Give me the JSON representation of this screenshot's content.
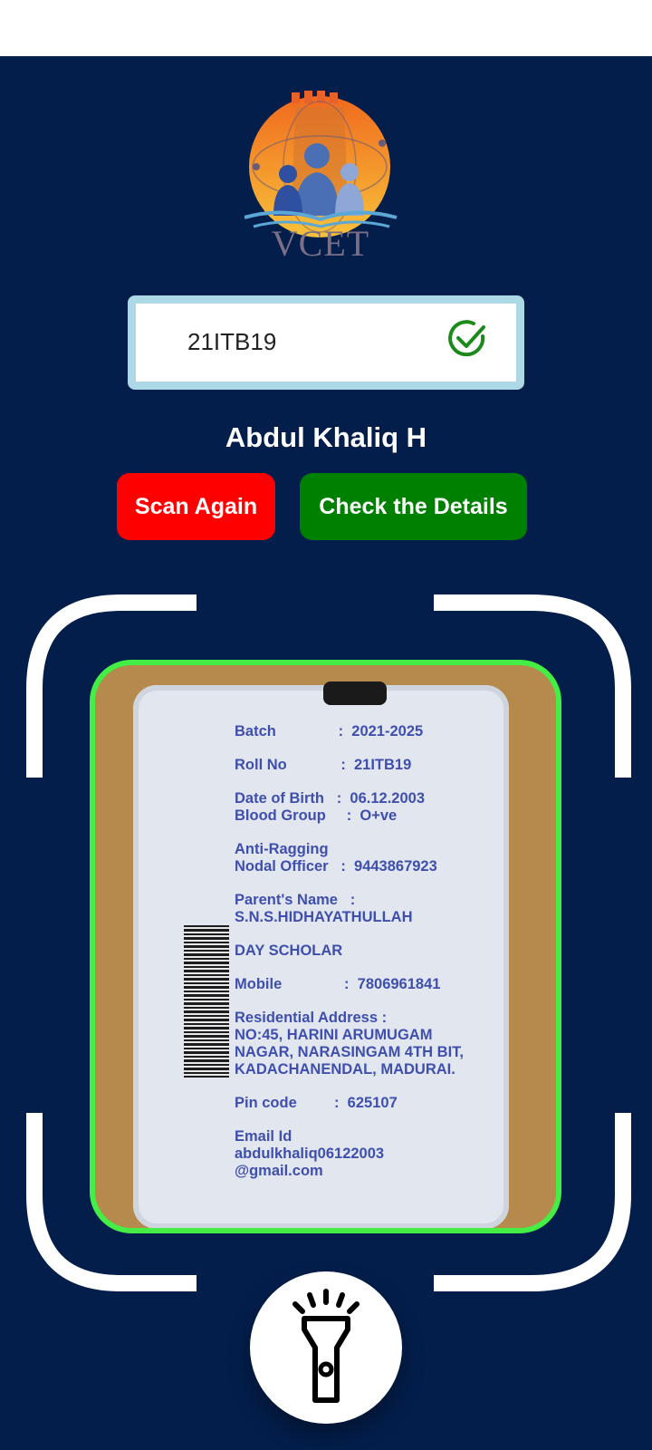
{
  "logo": {
    "text": "VCET",
    "icon": "vcet-logo",
    "colors": {
      "sun": "#f2981f",
      "people": "#4a6fb5",
      "water": "#5ba7d6"
    }
  },
  "scan": {
    "roll_number": "21ITB19",
    "status_icon": "check-circle-icon",
    "status_color": "#1b8a1b"
  },
  "student": {
    "name": "Abdul Khaliq H"
  },
  "actions": {
    "scan_again_label": "Scan Again",
    "check_details_label": "Check the Details",
    "scan_again_color": "#ff0000",
    "check_details_color": "#008000"
  },
  "camera_preview": {
    "border_color": "#44ee44",
    "card_text": [
      "Batch               :  2021-2025",
      "Roll No             :  21ITB19",
      "Date of Birth   :  06.12.2003",
      "Blood Group     :  O+ve",
      "Anti-Ragging",
      "Nodal Officer   :  9443867923",
      "Parent's Name   :",
      "S.N.S.HIDHAYATHULLAH",
      "DAY SCHOLAR",
      "Mobile               :  7806961841",
      "Residential Address :",
      "NO:45, HARINI ARUMUGAM",
      "NAGAR, NARASINGAM 4TH BIT,",
      "KADACHANENDAL, MADURAI.",
      "Pin code         :  625107",
      "Email Id",
      "abdulkhaliq06122003",
      "@gmail.com"
    ]
  },
  "flashlight": {
    "icon": "flashlight-icon"
  },
  "theme": {
    "background": "#031e4b",
    "input_border": "#add8e6"
  }
}
